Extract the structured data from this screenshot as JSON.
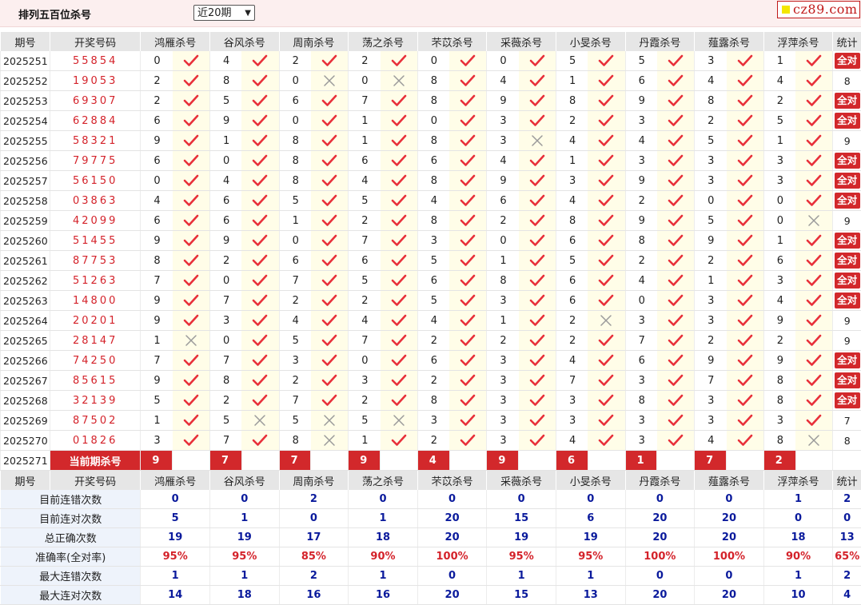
{
  "header": {
    "title": "排列五百位杀号",
    "period_select": "近20期",
    "logo_text": "cz89.com"
  },
  "columns": {
    "issue": "期号",
    "draw": "开奖号码",
    "experts": [
      "鸿雁杀号",
      "谷风杀号",
      "周南杀号",
      "荡之杀号",
      "芣苡杀号",
      "采薇杀号",
      "小旻杀号",
      "丹霞杀号",
      "薤露杀号",
      "浮萍杀号"
    ],
    "total": "统计"
  },
  "rows": [
    {
      "issue": "2025251",
      "draw": "55854",
      "kills": [
        "0",
        "4",
        "2",
        "2",
        "0",
        "0",
        "5",
        "5",
        "3",
        "1"
      ],
      "ok": [
        1,
        1,
        1,
        1,
        1,
        1,
        1,
        1,
        1,
        1
      ],
      "total": "全对"
    },
    {
      "issue": "2025252",
      "draw": "19053",
      "kills": [
        "2",
        "8",
        "0",
        "0",
        "8",
        "4",
        "1",
        "6",
        "4",
        "4"
      ],
      "ok": [
        1,
        1,
        0,
        0,
        1,
        1,
        1,
        1,
        1,
        1
      ],
      "total": "8"
    },
    {
      "issue": "2025253",
      "draw": "69307",
      "kills": [
        "2",
        "5",
        "6",
        "7",
        "8",
        "9",
        "8",
        "9",
        "8",
        "2"
      ],
      "ok": [
        1,
        1,
        1,
        1,
        1,
        1,
        1,
        1,
        1,
        1
      ],
      "total": "全对"
    },
    {
      "issue": "2025254",
      "draw": "62884",
      "kills": [
        "6",
        "9",
        "0",
        "1",
        "0",
        "3",
        "2",
        "3",
        "2",
        "5"
      ],
      "ok": [
        1,
        1,
        1,
        1,
        1,
        1,
        1,
        1,
        1,
        1
      ],
      "total": "全对"
    },
    {
      "issue": "2025255",
      "draw": "58321",
      "kills": [
        "9",
        "1",
        "8",
        "1",
        "8",
        "3",
        "4",
        "4",
        "5",
        "1"
      ],
      "ok": [
        1,
        1,
        1,
        1,
        1,
        0,
        1,
        1,
        1,
        1
      ],
      "total": "9"
    },
    {
      "issue": "2025256",
      "draw": "79775",
      "kills": [
        "6",
        "0",
        "8",
        "6",
        "6",
        "4",
        "1",
        "3",
        "3",
        "3"
      ],
      "ok": [
        1,
        1,
        1,
        1,
        1,
        1,
        1,
        1,
        1,
        1
      ],
      "total": "全对"
    },
    {
      "issue": "2025257",
      "draw": "56150",
      "kills": [
        "0",
        "4",
        "8",
        "4",
        "8",
        "9",
        "3",
        "9",
        "3",
        "3"
      ],
      "ok": [
        1,
        1,
        1,
        1,
        1,
        1,
        1,
        1,
        1,
        1
      ],
      "total": "全对"
    },
    {
      "issue": "2025258",
      "draw": "03863",
      "kills": [
        "4",
        "6",
        "5",
        "5",
        "4",
        "6",
        "4",
        "2",
        "0",
        "0"
      ],
      "ok": [
        1,
        1,
        1,
        1,
        1,
        1,
        1,
        1,
        1,
        1
      ],
      "total": "全对"
    },
    {
      "issue": "2025259",
      "draw": "42099",
      "kills": [
        "6",
        "6",
        "1",
        "2",
        "8",
        "2",
        "8",
        "9",
        "5",
        "0"
      ],
      "ok": [
        1,
        1,
        1,
        1,
        1,
        1,
        1,
        1,
        1,
        0
      ],
      "total": "9"
    },
    {
      "issue": "2025260",
      "draw": "51455",
      "kills": [
        "9",
        "9",
        "0",
        "7",
        "3",
        "0",
        "6",
        "8",
        "9",
        "1"
      ],
      "ok": [
        1,
        1,
        1,
        1,
        1,
        1,
        1,
        1,
        1,
        1
      ],
      "total": "全对"
    },
    {
      "issue": "2025261",
      "draw": "87753",
      "kills": [
        "8",
        "2",
        "6",
        "6",
        "5",
        "1",
        "5",
        "2",
        "2",
        "6"
      ],
      "ok": [
        1,
        1,
        1,
        1,
        1,
        1,
        1,
        1,
        1,
        1
      ],
      "total": "全对"
    },
    {
      "issue": "2025262",
      "draw": "51263",
      "kills": [
        "7",
        "0",
        "7",
        "5",
        "6",
        "8",
        "6",
        "4",
        "1",
        "3"
      ],
      "ok": [
        1,
        1,
        1,
        1,
        1,
        1,
        1,
        1,
        1,
        1
      ],
      "total": "全对"
    },
    {
      "issue": "2025263",
      "draw": "14800",
      "kills": [
        "9",
        "7",
        "2",
        "2",
        "5",
        "3",
        "6",
        "0",
        "3",
        "4"
      ],
      "ok": [
        1,
        1,
        1,
        1,
        1,
        1,
        1,
        1,
        1,
        1
      ],
      "total": "全对"
    },
    {
      "issue": "2025264",
      "draw": "20201",
      "kills": [
        "9",
        "3",
        "4",
        "4",
        "4",
        "1",
        "2",
        "3",
        "3",
        "9"
      ],
      "ok": [
        1,
        1,
        1,
        1,
        1,
        1,
        0,
        1,
        1,
        1
      ],
      "total": "9"
    },
    {
      "issue": "2025265",
      "draw": "28147",
      "kills": [
        "1",
        "0",
        "5",
        "7",
        "2",
        "2",
        "2",
        "7",
        "2",
        "2"
      ],
      "ok": [
        0,
        1,
        1,
        1,
        1,
        1,
        1,
        1,
        1,
        1
      ],
      "total": "9"
    },
    {
      "issue": "2025266",
      "draw": "74250",
      "kills": [
        "7",
        "7",
        "3",
        "0",
        "6",
        "3",
        "4",
        "6",
        "9",
        "9"
      ],
      "ok": [
        1,
        1,
        1,
        1,
        1,
        1,
        1,
        1,
        1,
        1
      ],
      "total": "全对"
    },
    {
      "issue": "2025267",
      "draw": "85615",
      "kills": [
        "9",
        "8",
        "2",
        "3",
        "2",
        "3",
        "7",
        "3",
        "7",
        "8"
      ],
      "ok": [
        1,
        1,
        1,
        1,
        1,
        1,
        1,
        1,
        1,
        1
      ],
      "total": "全对"
    },
    {
      "issue": "2025268",
      "draw": "32139",
      "kills": [
        "5",
        "2",
        "7",
        "2",
        "8",
        "3",
        "3",
        "8",
        "3",
        "8"
      ],
      "ok": [
        1,
        1,
        1,
        1,
        1,
        1,
        1,
        1,
        1,
        1
      ],
      "total": "全对"
    },
    {
      "issue": "2025269",
      "draw": "87502",
      "kills": [
        "1",
        "5",
        "5",
        "5",
        "3",
        "3",
        "3",
        "3",
        "3",
        "3"
      ],
      "ok": [
        1,
        0,
        0,
        0,
        1,
        1,
        1,
        1,
        1,
        1
      ],
      "total": "7"
    },
    {
      "issue": "2025270",
      "draw": "01826",
      "kills": [
        "3",
        "7",
        "8",
        "1",
        "2",
        "3",
        "4",
        "3",
        "4",
        "8"
      ],
      "ok": [
        1,
        1,
        0,
        1,
        1,
        1,
        1,
        1,
        1,
        0
      ],
      "total": "8"
    }
  ],
  "current": {
    "issue": "2025271",
    "label": "当前期杀号",
    "kills": [
      "9",
      "7",
      "7",
      "9",
      "4",
      "9",
      "6",
      "1",
      "7",
      "2"
    ]
  },
  "stats": [
    {
      "label": "目前连错次数",
      "values": [
        "0",
        "0",
        "2",
        "0",
        "0",
        "0",
        "0",
        "0",
        "0",
        "1",
        "2"
      ]
    },
    {
      "label": "目前连对次数",
      "values": [
        "5",
        "1",
        "0",
        "1",
        "20",
        "15",
        "6",
        "20",
        "20",
        "0",
        "0"
      ]
    },
    {
      "label": "总正确次数",
      "values": [
        "19",
        "19",
        "17",
        "18",
        "20",
        "19",
        "19",
        "20",
        "20",
        "18",
        "13"
      ]
    },
    {
      "label": "准确率(全对率)",
      "values": [
        "95%",
        "95%",
        "85%",
        "90%",
        "100%",
        "95%",
        "95%",
        "100%",
        "100%",
        "90%",
        "65%"
      ]
    },
    {
      "label": "最大连错次数",
      "values": [
        "1",
        "1",
        "2",
        "1",
        "0",
        "1",
        "1",
        "0",
        "0",
        "1",
        "2"
      ]
    },
    {
      "label": "最大连对次数",
      "values": [
        "14",
        "18",
        "16",
        "16",
        "20",
        "15",
        "13",
        "20",
        "20",
        "10",
        "4"
      ]
    }
  ],
  "icons": {
    "ok": "check-icon",
    "bad": "cross-icon"
  },
  "colors": {
    "accent": "#d2282b",
    "check": "#e8303a",
    "cross": "#9a9a9a",
    "stat_blue": "#0a1a9c",
    "mark_bg": "#fffde8"
  }
}
